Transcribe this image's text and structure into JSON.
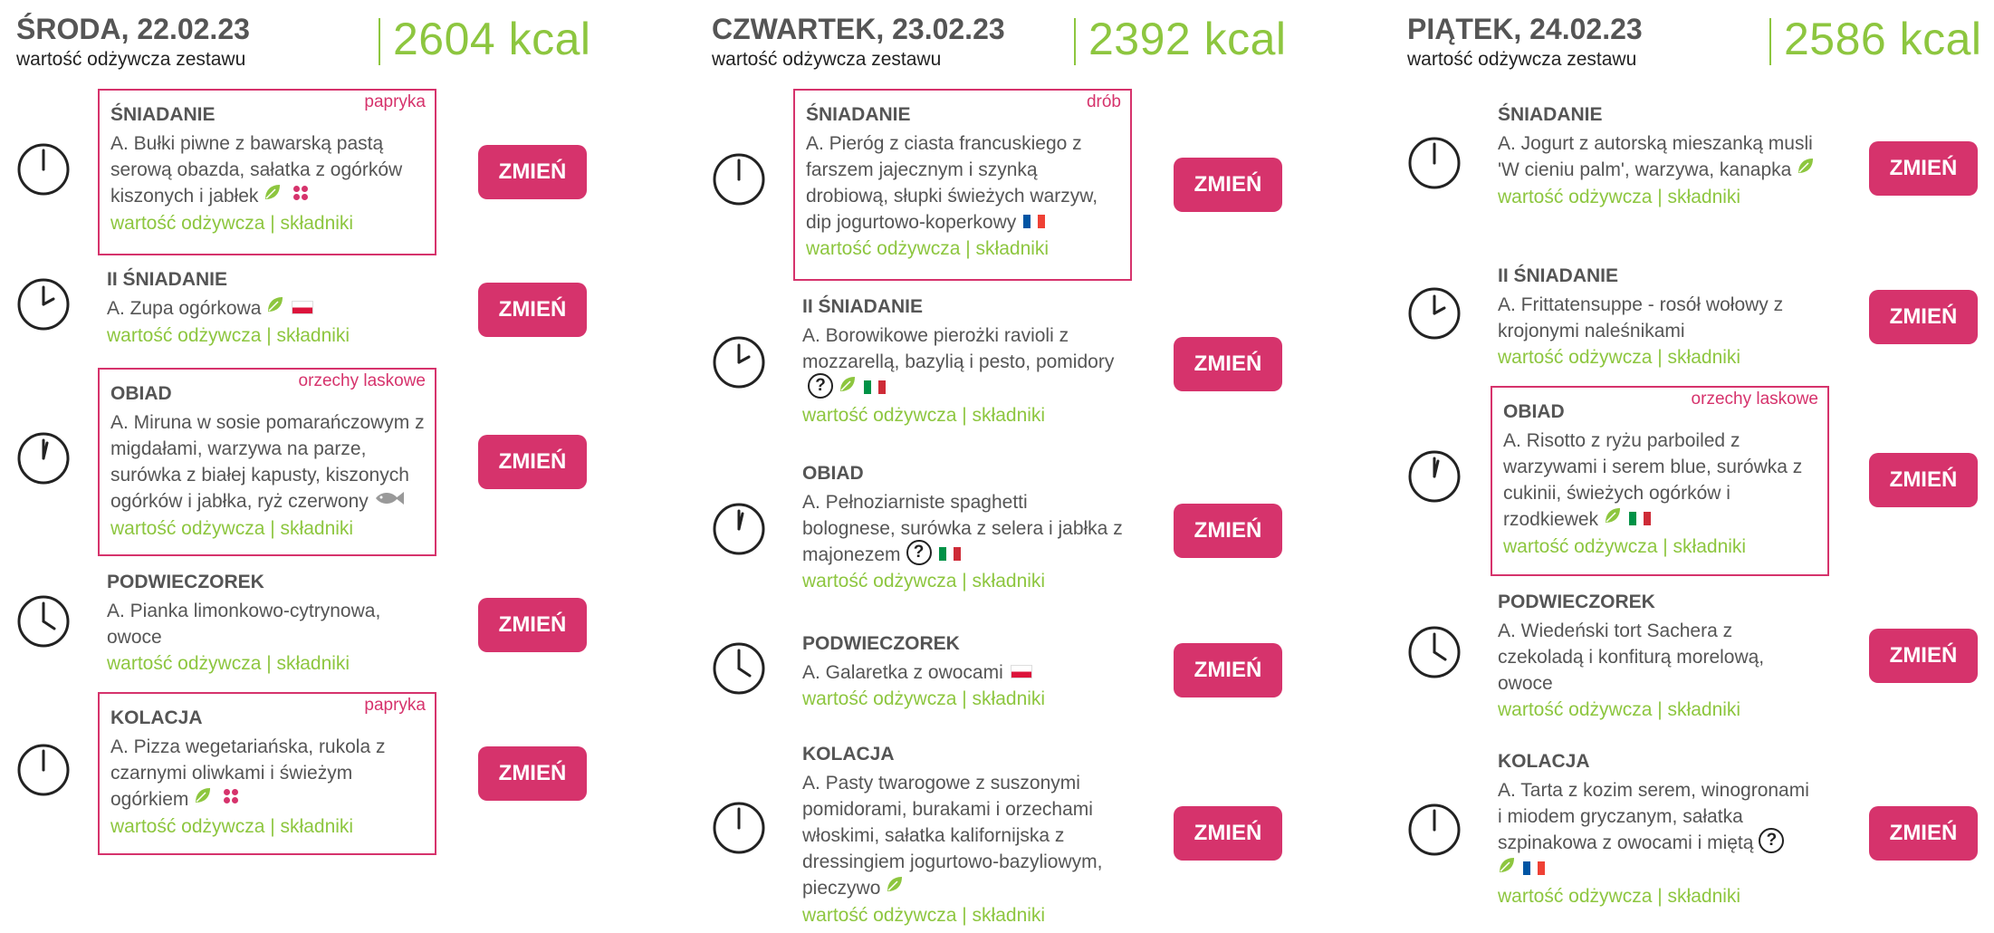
{
  "change_label": "ZMIEŃ",
  "links": {
    "nutrition": "wartość odżywcza",
    "separator": "|",
    "ingredients": "składniki"
  },
  "colors": {
    "accent_green": "#8dc63f",
    "accent_pink": "#d6336c",
    "text_gray": "#555555"
  },
  "days": [
    {
      "title": "ŚRODA, 22.02.23",
      "subtitle": "wartość odżywcza zestawu",
      "kcal": "2604 kcal",
      "meals": [
        {
          "name": "ŚNIADANIE",
          "allergen": "papryka",
          "desc": "A. Bułki piwne z bawarską pastą serową obazda, sałatka z ogórków kiszonych i jabłek",
          "icons": [
            "leaf-icon",
            "dots-icon"
          ],
          "clock": "clock-12-icon"
        },
        {
          "name": "II ŚNIADANIE",
          "allergen": "",
          "desc": "A. Zupa ogórkowa",
          "icons": [
            "leaf-icon",
            "flag-pl-icon"
          ],
          "clock": "clock-2-icon"
        },
        {
          "name": "OBIAD",
          "allergen": "orzechy laskowe",
          "desc": "A. Miruna w sosie pomarańczowym z migdałami, warzywa na parze, surówka z białej kapusty, kiszonych ogórków i jabłka, ryż czerwony",
          "icons": [
            "fish-icon"
          ],
          "clock": "clock-1-icon"
        },
        {
          "name": "PODWIECZOREK",
          "allergen": "",
          "desc": "A. Pianka limonkowo-cytrynowa, owoce",
          "icons": [],
          "clock": "clock-4-icon"
        },
        {
          "name": "KOLACJA",
          "allergen": "papryka",
          "desc": "A. Pizza wegetariańska, rukola z czarnymi oliwkami i świeżym ogórkiem",
          "icons": [
            "leaf-icon",
            "dots-icon"
          ],
          "clock": "clock-12-icon"
        }
      ]
    },
    {
      "title": "CZWARTEK, 23.02.23",
      "subtitle": "wartość odżywcza zestawu",
      "kcal": "2392 kcal",
      "meals": [
        {
          "name": "ŚNIADANIE",
          "allergen": "drób",
          "desc": "A. Pieróg z ciasta francuskiego z farszem jajecznym i szynką drobiową, słupki świeżych warzyw, dip jogurtowo-koperkowy",
          "icons": [
            "flag-fr-icon"
          ],
          "clock": "clock-12-icon"
        },
        {
          "name": "II ŚNIADANIE",
          "allergen": "",
          "desc": "A. Borowikowe pierożki ravioli z mozzarellą, bazylią i pesto, pomidory",
          "icons": [
            "question-icon",
            "leaf-icon",
            "flag-it-icon"
          ],
          "clock": "clock-2-icon"
        },
        {
          "name": "OBIAD",
          "allergen": "",
          "desc": "A. Pełnoziarniste spaghetti bolognese, surówka z selera i jabłka z majonezem",
          "icons": [
            "question-icon",
            "flag-it-icon"
          ],
          "clock": "clock-1-icon"
        },
        {
          "name": "PODWIECZOREK",
          "allergen": "",
          "desc": "A. Galaretka z owocami",
          "icons": [
            "flag-pl-icon"
          ],
          "clock": "clock-4-icon"
        },
        {
          "name": "KOLACJA",
          "allergen": "",
          "desc": "A. Pasty twarogowe z suszonymi pomidorami, burakami i orzechami włoskimi, sałatka kalifornijska z dressingiem jogurtowo-bazyliowym, pieczywo",
          "icons": [
            "leaf-icon"
          ],
          "clock": "clock-12-icon"
        }
      ]
    },
    {
      "title": "PIĄTEK, 24.02.23",
      "subtitle": "wartość odżywcza zestawu",
      "kcal": "2586 kcal",
      "meals": [
        {
          "name": "ŚNIADANIE",
          "allergen": "",
          "desc": "A. Jogurt z autorską mieszanką musli 'W cieniu palm', warzywa, kanapka",
          "icons": [
            "leaf-icon"
          ],
          "clock": "clock-12-icon"
        },
        {
          "name": "II ŚNIADANIE",
          "allergen": "",
          "desc": "A. Frittatensuppe - rosół wołowy z krojonymi naleśnikami",
          "icons": [],
          "clock": "clock-2-icon"
        },
        {
          "name": "OBIAD",
          "allergen": "orzechy laskowe",
          "desc": "A. Risotto z ryżu parboiled z warzywami i serem blue, surówka z cukinii, świeżych ogórków i rzodkiewek",
          "icons": [
            "leaf-icon",
            "flag-it-icon"
          ],
          "clock": "clock-1-icon"
        },
        {
          "name": "PODWIECZOREK",
          "allergen": "",
          "desc": "A. Wiedeński tort Sachera z czekoladą i konfiturą morelową, owoce",
          "icons": [],
          "clock": "clock-4-icon"
        },
        {
          "name": "KOLACJA",
          "allergen": "",
          "desc": "A. Tarta z kozim serem, winogronami i miodem gryczanym, sałatka szpinakowa z owocami i miętą",
          "icons": [
            "question-icon",
            "leaf-icon",
            "flag-fr-icon"
          ],
          "clock": "clock-12-icon"
        }
      ]
    }
  ]
}
